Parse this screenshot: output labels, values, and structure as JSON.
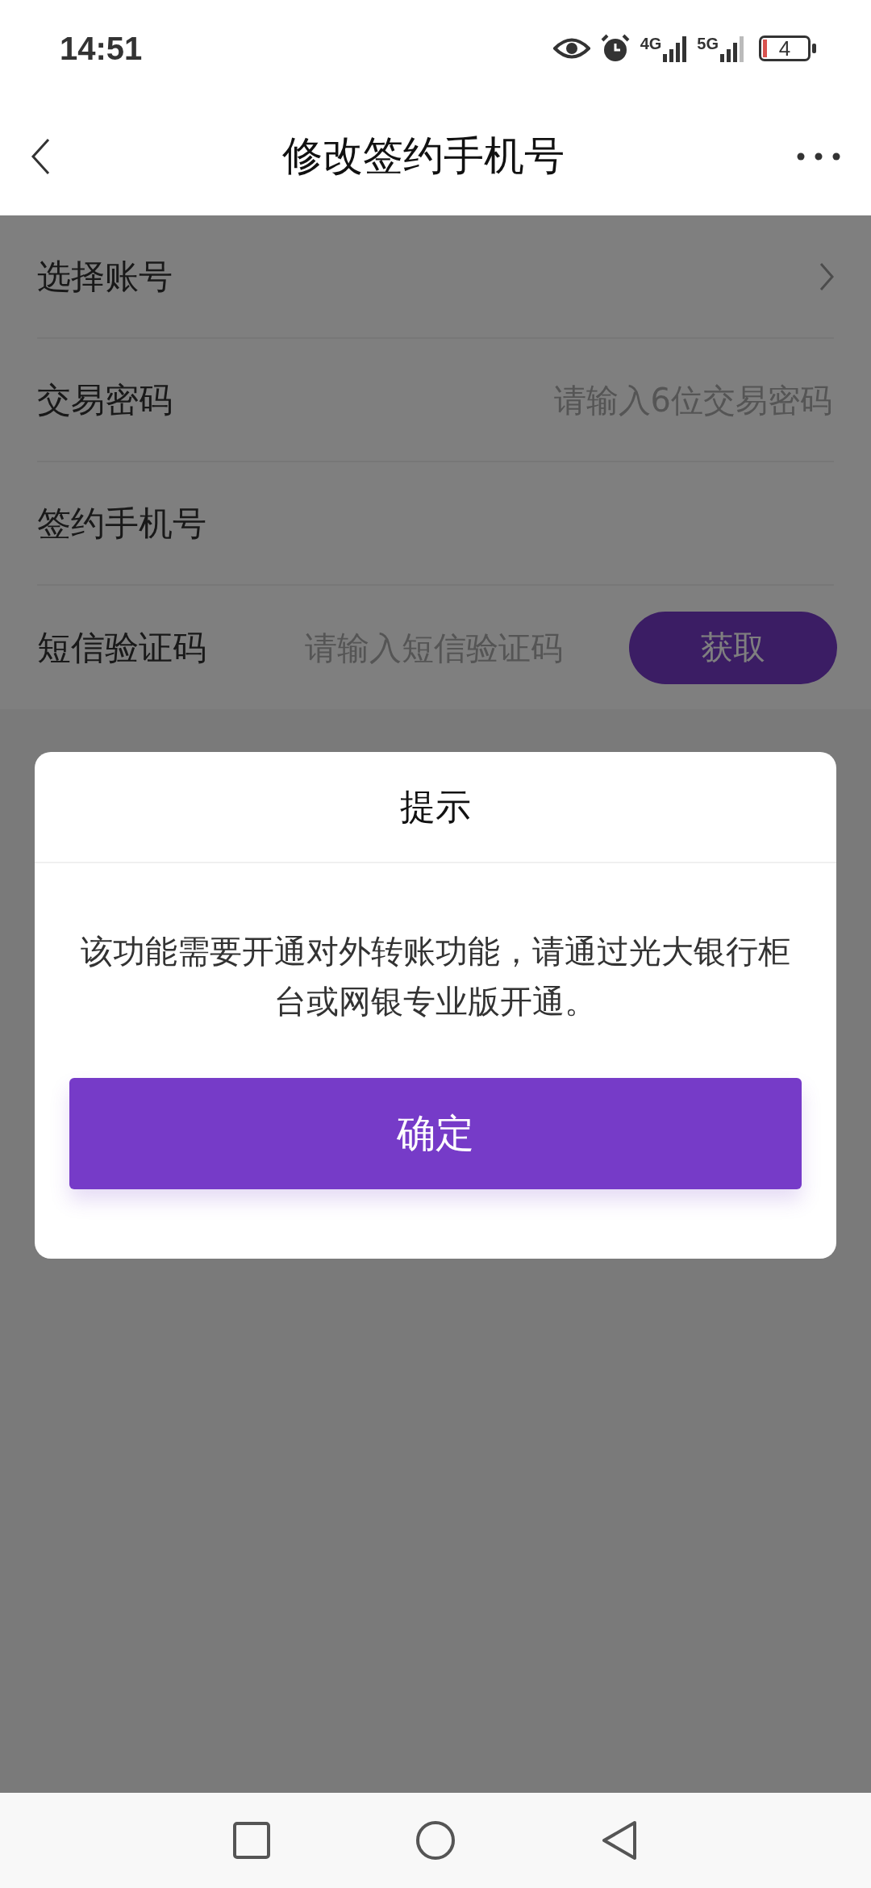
{
  "status_bar": {
    "time": "14:51",
    "network_1": "4G",
    "network_2": "5G",
    "battery": "4"
  },
  "header": {
    "title": "修改签约手机号"
  },
  "form_rows": [
    {
      "kind": "select",
      "label": "选择账号"
    },
    {
      "kind": "input",
      "label": "交易密码",
      "placeholder": "请输入6位交易密码"
    },
    {
      "kind": "text",
      "label": "签约手机号"
    },
    {
      "kind": "sms",
      "label": "短信验证码",
      "placeholder": "请输入短信验证码",
      "button": "获取"
    }
  ],
  "dialog": {
    "title": "提示",
    "message": "该功能需要开通对外转账功能，请通过光大银行柜台或网银专业版开通。",
    "button": "确定"
  }
}
